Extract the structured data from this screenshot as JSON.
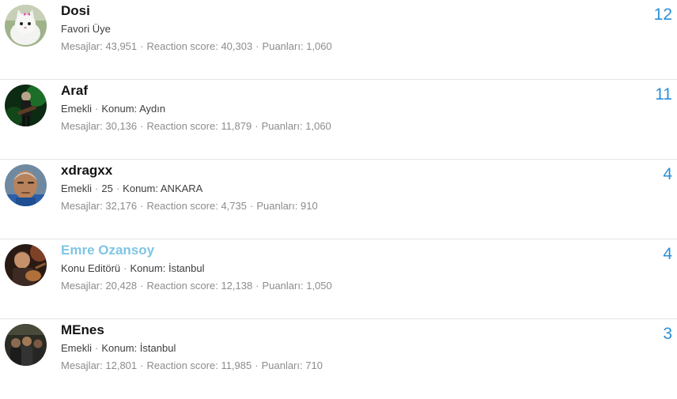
{
  "members": [
    {
      "username": "Dosi",
      "title": "Favori Üye",
      "age": "",
      "location_label": "",
      "location": "",
      "stats": {
        "messages_label": "Mesajlar:",
        "messages": "43,951",
        "reaction_label": "Reaction score:",
        "reaction": "40,303",
        "points_label": "Puanları:",
        "points": "1,060"
      },
      "count": "12",
      "avatar_icon": "white-kitten-avatar",
      "name_color": "#141414"
    },
    {
      "username": "Araf",
      "title": "Emekli",
      "age": "",
      "location_label": "Konum:",
      "location": "Aydın",
      "stats": {
        "messages_label": "Mesajlar:",
        "messages": "30,136",
        "reaction_label": "Reaction score:",
        "reaction": "11,879",
        "points_label": "Puanları:",
        "points": "1,060"
      },
      "count": "11",
      "avatar_icon": "guitarist-green-avatar",
      "name_color": "#141414"
    },
    {
      "username": "xdragxx",
      "title": "Emekli",
      "age": "25",
      "location_label": "Konum:",
      "location": "ANKARA",
      "stats": {
        "messages_label": "Mesajlar:",
        "messages": "32,176",
        "reaction_label": "Reaction score:",
        "reaction": "4,735",
        "points_label": "Puanları:",
        "points": "910"
      },
      "count": "4",
      "avatar_icon": "man-face-avatar",
      "name_color": "#141414"
    },
    {
      "username": "Emre Ozansoy",
      "title": "Konu Editörü",
      "age": "",
      "location_label": "Konum:",
      "location": "İstanbul",
      "stats": {
        "messages_label": "Mesajlar:",
        "messages": "20,428",
        "reaction_label": "Reaction score:",
        "reaction": "12,138",
        "points_label": "Puanları:",
        "points": "1,050"
      },
      "count": "4",
      "avatar_icon": "man-with-guitar-avatar",
      "name_color": "#7fc5e3"
    },
    {
      "username": "MEnes",
      "title": "Emekli",
      "age": "",
      "location_label": "Konum:",
      "location": "İstanbul",
      "stats": {
        "messages_label": "Mesajlar:",
        "messages": "12,801",
        "reaction_label": "Reaction score:",
        "reaction": "11,985",
        "points_label": "Puanları:",
        "points": "710"
      },
      "count": "3",
      "avatar_icon": "group-photo-avatar",
      "name_color": "#141414"
    }
  ],
  "colors": {
    "count": "#2e8fd6",
    "stats": "#8c8c8c",
    "title": "#3e3e3e",
    "divider": "#e3e3e3"
  }
}
